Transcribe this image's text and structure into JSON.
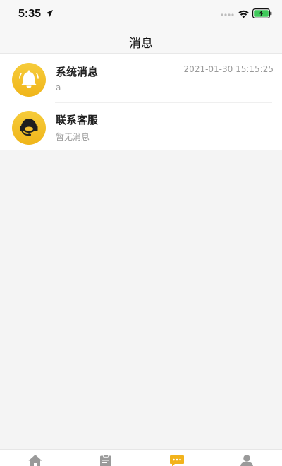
{
  "status_bar": {
    "time": "5:35"
  },
  "nav": {
    "title": "消息"
  },
  "messages": [
    {
      "title": "系统消息",
      "preview": "a",
      "time": "2021-01-30 15:15:25",
      "icon": "bell-icon"
    },
    {
      "title": "联系客服",
      "preview": "暂无消息",
      "time": "",
      "icon": "headset-icon"
    }
  ],
  "tab_bar": {
    "items": [
      {
        "icon": "home-icon",
        "active": false
      },
      {
        "icon": "clipboard-icon",
        "active": false
      },
      {
        "icon": "chat-icon",
        "active": true
      },
      {
        "icon": "user-icon",
        "active": false
      }
    ],
    "active_color": "#f2b31c",
    "inactive_color": "#9a9a9a"
  },
  "colors": {
    "accent": "#f2b31c",
    "background": "#f4f4f4"
  }
}
